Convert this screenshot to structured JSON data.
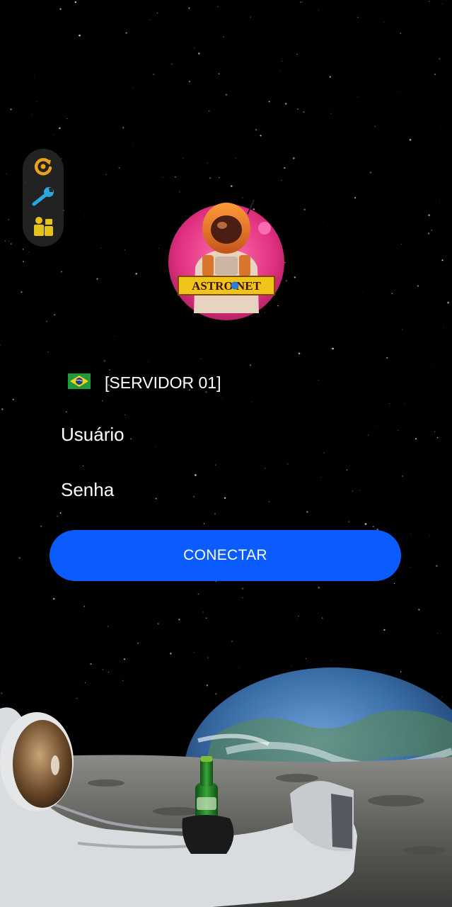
{
  "server": {
    "flag_icon": "brazil-flag-icon",
    "label": "[SERVIDOR 01]"
  },
  "form": {
    "username_placeholder": "Usuário",
    "password_placeholder": "Senha",
    "connect_label": "CONECTAR"
  },
  "logo": {
    "brand_text": "ASTRO NET"
  },
  "side_tools": [
    {
      "icon": "refresh-icon"
    },
    {
      "icon": "wrench-icon"
    },
    {
      "icon": "users-icon"
    }
  ],
  "colors": {
    "accent": "#0a5cff",
    "background": "#000000",
    "tool_orange": "#e8a21c",
    "tool_blue": "#29a8e0",
    "tool_yellow": "#e6c21a"
  }
}
